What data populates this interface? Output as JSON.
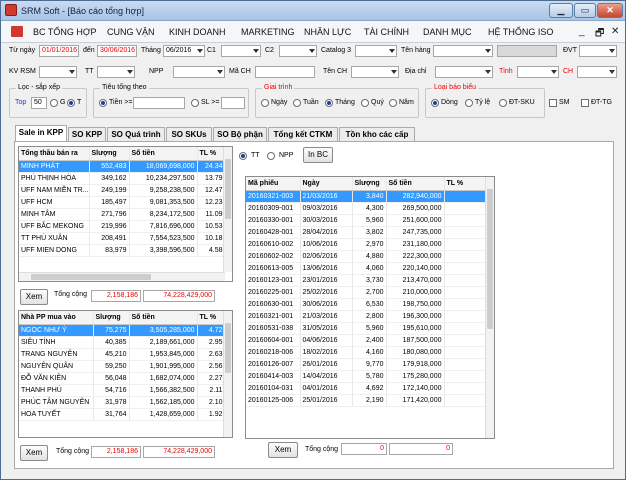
{
  "window": {
    "title": "SRM Soft - [Báo cáo tổng hợp]",
    "min": "▁",
    "max": "▭",
    "close": "✕"
  },
  "menu": {
    "items": [
      "BC TỔNG HỢP",
      "CUNG VẬN",
      "KINH DOANH",
      "MARKETING",
      "NHÂN LỰC",
      "TÀI CHÍNH",
      "DANH MỤC",
      "HỆ THỐNG ISO"
    ],
    "mdi": [
      "_",
      "🗗",
      "✕"
    ]
  },
  "filters": {
    "from_label": "Từ ngày",
    "from_value": "01/01/2016",
    "to_label": "đến",
    "to_value": "30/06/2016",
    "month_label": "Tháng",
    "month_value": "06/2016",
    "c1_label": "C1",
    "c2_label": "C2",
    "catalog_label": "Catalog 3",
    "ten_hang_label": "Tên hàng",
    "dvt_label": "ĐVT",
    "kvrsm_label": "KV RSM",
    "tt_label": "TT",
    "npp_label": "NPP",
    "mach_label": "Mã CH",
    "tench_label": "Tên CH",
    "diachi_label": "Địa chỉ",
    "tinh_label": "Tỉnh",
    "ch_label": "CH"
  },
  "sort": {
    "title": "Lọc - sắp xếp",
    "top_label": "Top",
    "top_value": "50",
    "g_label": "G",
    "t_label": "T"
  },
  "sum": {
    "title": "Tiêu tổng theo",
    "tien_label": "Tiền >=",
    "sl_label": "SL >="
  },
  "period": {
    "title": "Giai trình",
    "options": [
      "Ngày",
      "Tuần",
      "Tháng",
      "Quý",
      "Năm"
    ],
    "selected": "Tháng"
  },
  "report_type": {
    "title": "Loại báo biểu",
    "options": [
      "Dòng",
      "Tỷ lệ",
      "ĐT-SKU"
    ],
    "sm_label": "SM",
    "dttg_label": "ĐT-TG",
    "selected": "Dòng"
  },
  "tabs": [
    "Sale in KPP",
    "SO KPP",
    "SO Quá trình",
    "SO SKUs",
    "SO Bộ phận",
    "Tổng kết CTKM",
    "Tồn kho các cấp"
  ],
  "table1": {
    "headers": [
      "Tổng thầu bán ra",
      "Slượng",
      "Số tiền",
      "TL %"
    ],
    "rows": [
      [
        "MINH PHÁT",
        "552,483",
        "18,069,698,000",
        "24.34"
      ],
      [
        "PHÚ THỊNH HÒA",
        "349,162",
        "10,234,297,500",
        "13.79"
      ],
      [
        "UFF NAM MIỀN TR...",
        "249,199",
        "9,258,238,500",
        "12.47"
      ],
      [
        "UFF HCM",
        "185,497",
        "9,081,353,500",
        "12.23"
      ],
      [
        "MINH TÂM",
        "271,796",
        "8,234,172,500",
        "11.09"
      ],
      [
        "UFF BẮC MEKONG",
        "219,996",
        "7,816,696,000",
        "10.53"
      ],
      [
        "TT PHÚ XUÂN",
        "208,491",
        "7,554,523,500",
        "10.18"
      ],
      [
        "UFF MIEN DONG",
        "83,979",
        "3,398,596,500",
        "4.58"
      ]
    ],
    "xem": "Xem",
    "total_label": "Tổng cộng",
    "total_qty": "2,158,186",
    "total_amount": "74,228,429,000"
  },
  "table2": {
    "headers": [
      "Nhà PP mua vào",
      "Slượng",
      "Số tiền",
      "TL %"
    ],
    "rows": [
      [
        "NGỌC NHƯ Ý",
        "75,275",
        "3,505,285,000",
        "4.72"
      ],
      [
        "SIÊU TÍNH",
        "40,385",
        "2,189,661,000",
        "2.95"
      ],
      [
        "TRANG NGUYÊN",
        "45,210",
        "1,953,845,000",
        "2.63"
      ],
      [
        "NGUYÊN QUÂN",
        "59,250",
        "1,901,995,000",
        "2.56"
      ],
      [
        "ĐỖ VĂN KIÊN",
        "56,048",
        "1,682,074,000",
        "2.27"
      ],
      [
        "THANH PHÚ",
        "54,716",
        "1,566,382,500",
        "2.11"
      ],
      [
        "PHÚC TÂM NGUYÊN",
        "31,978",
        "1,562,185,000",
        "2.10"
      ],
      [
        "HOA TUYẾT",
        "31,764",
        "1,428,659,000",
        "1.92"
      ]
    ],
    "xem": "Xem",
    "total_label": "Tổng cộng",
    "total_qty": "2,158,186",
    "total_amount": "74,228,429,000"
  },
  "right": {
    "tt_label": "TT",
    "npp_label": "NPP",
    "inbc": "In BC",
    "headers": [
      "Mã phiếu",
      "Ngày",
      "Slượng",
      "Số tiền",
      "TL %"
    ],
    "rows": [
      [
        "20160321-003",
        "21/03/2016",
        "3,840",
        "282,940,000",
        ""
      ],
      [
        "20160309-001",
        "09/03/2016",
        "4,300",
        "269,500,000",
        ""
      ],
      [
        "20160330-001",
        "30/03/2016",
        "5,960",
        "251,600,000",
        ""
      ],
      [
        "20160428-001",
        "28/04/2016",
        "3,802",
        "247,735,000",
        ""
      ],
      [
        "20160610-002",
        "10/06/2016",
        "2,970",
        "231,180,000",
        ""
      ],
      [
        "20160602-002",
        "02/06/2016",
        "4,880",
        "222,300,000",
        ""
      ],
      [
        "20160613-005",
        "13/06/2016",
        "4,060",
        "220,140,000",
        ""
      ],
      [
        "20160123-001",
        "23/01/2016",
        "3,730",
        "213,470,000",
        ""
      ],
      [
        "20160225-001",
        "25/02/2016",
        "2,700",
        "210,000,000",
        ""
      ],
      [
        "20160630-001",
        "30/06/2016",
        "6,530",
        "198,750,000",
        ""
      ],
      [
        "20160321-001",
        "21/03/2016",
        "2,800",
        "196,300,000",
        ""
      ],
      [
        "20160531-038",
        "31/05/2016",
        "5,960",
        "195,610,000",
        ""
      ],
      [
        "20160604-001",
        "04/06/2016",
        "2,400",
        "187,500,000",
        ""
      ],
      [
        "20160218-006",
        "18/02/2016",
        "4,160",
        "180,080,000",
        ""
      ],
      [
        "20160126-007",
        "26/01/2016",
        "9,770",
        "179,918,000",
        ""
      ],
      [
        "20160414-003",
        "14/04/2016",
        "5,780",
        "175,280,000",
        ""
      ],
      [
        "20160104-031",
        "04/01/2016",
        "4,692",
        "172,140,000",
        ""
      ],
      [
        "20160125-006",
        "25/01/2016",
        "2,190",
        "171,420,000",
        ""
      ]
    ],
    "xem": "Xem",
    "total_label": "Tổng cộng",
    "total_qty": "0",
    "total_amount": "0"
  },
  "colors": {
    "selection": "#3399ff",
    "accent_red": "#e00000",
    "blue": "#1a3ccc"
  }
}
